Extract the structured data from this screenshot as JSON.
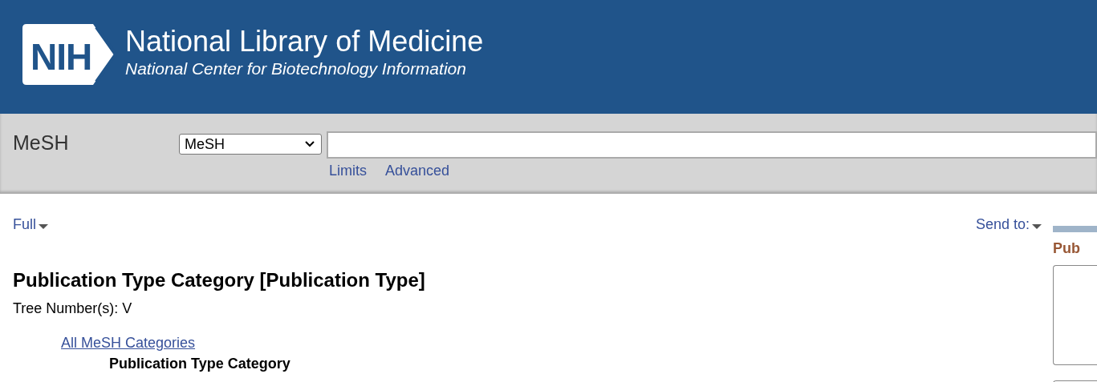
{
  "header": {
    "logo_text": "NIH",
    "title": "National Library of Medicine",
    "subtitle": "National Center for Biotechnology Information"
  },
  "search_bar": {
    "site_label": "MeSH",
    "database": "MeSH",
    "links": [
      "Limits",
      "Advanced"
    ]
  },
  "toolbar": {
    "format": "Full",
    "send_to": "Send to:"
  },
  "record": {
    "title": "Publication Type Category [Publication Type]",
    "tree_numbers": "Tree Number(s): V",
    "tree": [
      {
        "label": "All MeSH Categories",
        "kind": "link",
        "children": [
          {
            "label": "Publication Type Category",
            "kind": "current"
          }
        ]
      }
    ]
  },
  "sidebar": {
    "heading": "Pub"
  }
}
